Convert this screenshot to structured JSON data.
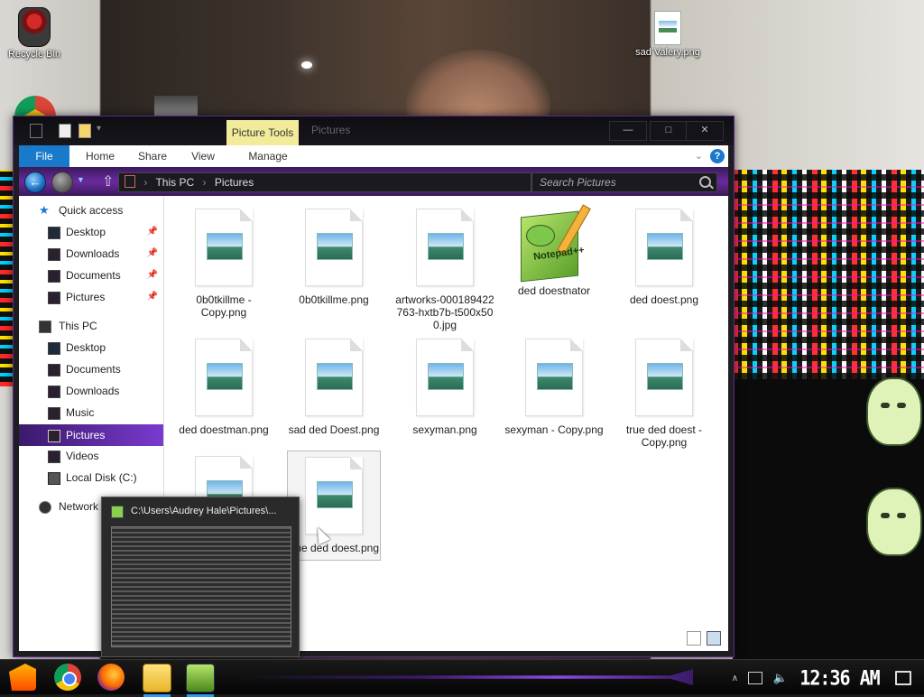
{
  "desktop": {
    "icons": [
      {
        "label": "Recycle Bin",
        "icon": "recycle-bin-icon"
      },
      {
        "label": "sad Valery.png",
        "icon": "image-file-icon"
      }
    ]
  },
  "window": {
    "title": "Pictures",
    "context_tab": "Picture Tools",
    "ribbon_tabs": [
      "File",
      "Home",
      "Share",
      "View",
      "Manage"
    ],
    "caption": {
      "minimize": "—",
      "maximize": "□",
      "close": "✕"
    },
    "help": "?",
    "breadcrumb": [
      "This PC",
      "Pictures"
    ],
    "search_placeholder": "Search Pictures"
  },
  "nav_pane": {
    "quick_access": {
      "label": "Quick access",
      "items": [
        {
          "label": "Desktop",
          "pinned": true
        },
        {
          "label": "Downloads",
          "pinned": true
        },
        {
          "label": "Documents",
          "pinned": true
        },
        {
          "label": "Pictures",
          "pinned": true
        }
      ]
    },
    "this_pc": {
      "label": "This PC",
      "items": [
        {
          "label": "Desktop"
        },
        {
          "label": "Documents"
        },
        {
          "label": "Downloads"
        },
        {
          "label": "Music"
        },
        {
          "label": "Pictures",
          "selected": true
        },
        {
          "label": "Videos"
        },
        {
          "label": "Local Disk (C:)"
        }
      ]
    },
    "network": {
      "label": "Network"
    }
  },
  "files": [
    {
      "name": "0b0tkillme - Copy.png",
      "type": "image"
    },
    {
      "name": "0b0tkillme.png",
      "type": "image"
    },
    {
      "name": "artworks-000189422763-hxtb7b-t500x500.jpg",
      "type": "image"
    },
    {
      "name": "ded doestnator",
      "type": "notepad"
    },
    {
      "name": "ded doest.png",
      "type": "image"
    },
    {
      "name": "ded doestman.png",
      "type": "image"
    },
    {
      "name": "sad ded Doest.png",
      "type": "image"
    },
    {
      "name": "sexyman.png",
      "type": "image"
    },
    {
      "name": "sexyman - Copy.png",
      "type": "image"
    },
    {
      "name": "true ded doest - Copy.png",
      "type": "image"
    },
    {
      "name": "",
      "type": "image"
    },
    {
      "name": "true ded doest.png",
      "type": "image",
      "highlighted": true
    }
  ],
  "taskbar_preview": {
    "title": "C:\\Users\\Audrey Hale\\Pictures\\..."
  },
  "taskbar": {
    "apps": [
      "start-icon",
      "chrome-icon",
      "firefox-icon",
      "file-explorer-icon",
      "notepad-plus-icon"
    ],
    "clock": "12:36 AM"
  }
}
